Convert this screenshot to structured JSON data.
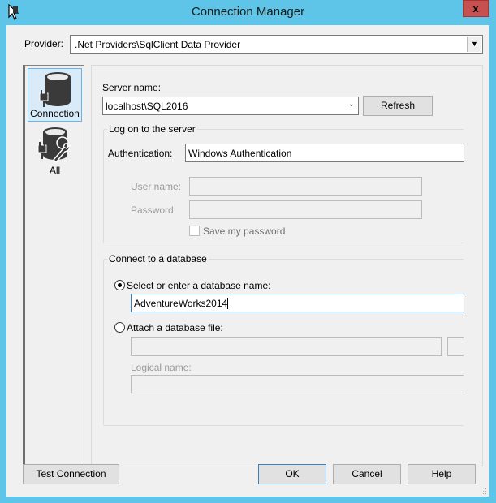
{
  "window": {
    "title": "Connection Manager",
    "close_label": "x"
  },
  "provider": {
    "label": "Provider:",
    "value": ".Net Providers\\SqlClient Data Provider"
  },
  "nav": {
    "items": [
      {
        "label": "Connection",
        "icon": "database-plug-icon",
        "selected": true
      },
      {
        "label": "All",
        "icon": "database-plug-wrench-icon",
        "selected": false
      }
    ]
  },
  "server": {
    "label": "Server name:",
    "value": "localhost\\SQL2016",
    "refresh_label": "Refresh"
  },
  "logon": {
    "group_title": "Log on to the server",
    "auth_label": "Authentication:",
    "auth_value": "Windows Authentication",
    "username_label": "User name:",
    "username_value": "",
    "password_label": "Password:",
    "password_value": "",
    "save_password_label": "Save my password",
    "save_password_checked": false
  },
  "database": {
    "group_title": "Connect to a database",
    "select_radio_label": "Select or enter a database name:",
    "select_radio_checked": true,
    "database_name": "AdventureWorks2014",
    "attach_radio_label": "Attach a database file:",
    "attach_radio_checked": false,
    "attach_file_value": "",
    "logical_name_label": "Logical name:",
    "logical_name_value": ""
  },
  "buttons": {
    "test_connection": "Test Connection",
    "ok": "OK",
    "cancel": "Cancel",
    "help": "Help"
  },
  "colors": {
    "frame": "#5ec5e8",
    "close": "#c75050",
    "selection": "#d9ebf9",
    "focus_border": "#3c7fb1"
  }
}
